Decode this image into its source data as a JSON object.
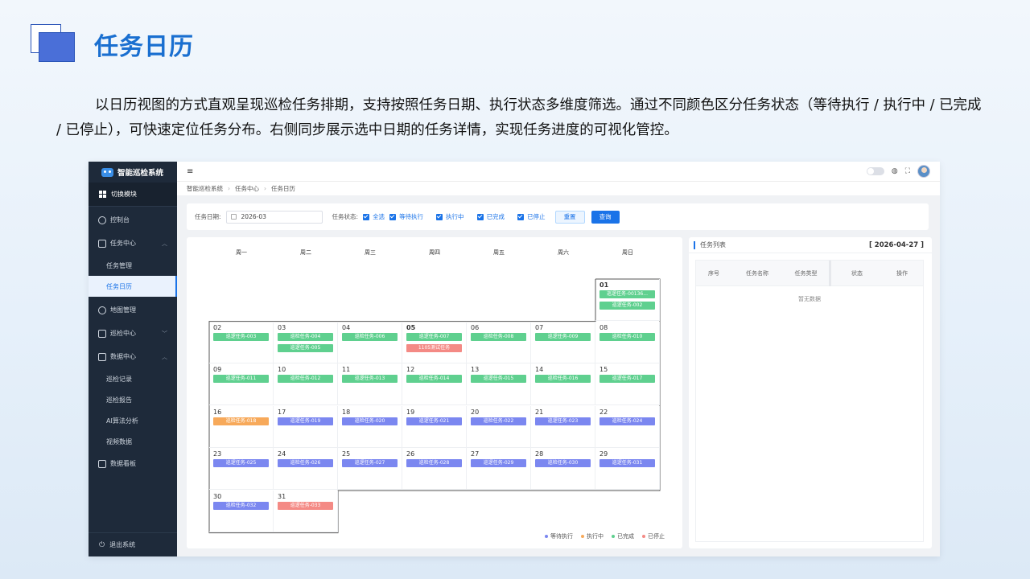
{
  "slide": {
    "title": "任务日历",
    "description": "以日历视图的方式直观呈现巡检任务排期，支持按照任务日期、执行状态多维度筛选。通过不同颜色区分任务状态（等待执行 / 执行中 / 已完成 / 已停止），可快速定位任务分布。右侧同步展示选中日期的任务详情，实现任务进度的可视化管控。"
  },
  "app": {
    "brand": "智能巡检系统",
    "module_switch": "切换模块",
    "nav": {
      "console": "控制台",
      "task_center": "任务中心",
      "task_manage": "任务管理",
      "task_calendar": "任务日历",
      "map_manage": "地图管理",
      "inspect_center": "巡检中心",
      "data_center": "数据中心",
      "inspect_record": "巡检记录",
      "inspect_report": "巡检报告",
      "ai_analysis": "AI算法分析",
      "video_data": "视频数据",
      "data_board": "数据看板",
      "logout": "退出系统"
    },
    "breadcrumb": [
      "智能巡检系统",
      "任务中心",
      "任务日历"
    ],
    "filter": {
      "date_label": "任务日期:",
      "date_value": "2026-03",
      "status_label": "任务状态:",
      "options": [
        "全选",
        "等待执行",
        "执行中",
        "已完成",
        "已停止"
      ],
      "reset": "重置",
      "query": "查询"
    },
    "weekdays": [
      "周一",
      "周二",
      "周三",
      "周四",
      "周五",
      "周六",
      "周日"
    ],
    "legend": [
      {
        "label": "等待执行",
        "color": "#7b87f0"
      },
      {
        "label": "执行中",
        "color": "#f7a95a"
      },
      {
        "label": "已完成",
        "color": "#5fd08f"
      },
      {
        "label": "已停止",
        "color": "#f48a85"
      }
    ],
    "days": [
      {
        "day": "01",
        "col": 6,
        "row": 0,
        "bold": true,
        "tasks": [
          {
            "name": "巡逻任务-00136...",
            "s": "done"
          },
          {
            "name": "巡逻任务-002",
            "s": "done"
          }
        ]
      },
      {
        "day": "02",
        "col": 0,
        "row": 1,
        "tasks": [
          {
            "name": "巡逻任务-003",
            "s": "done"
          }
        ]
      },
      {
        "day": "03",
        "col": 1,
        "row": 1,
        "tasks": [
          {
            "name": "巡检任务-004",
            "s": "done"
          },
          {
            "name": "巡逻任务-005",
            "s": "done"
          }
        ]
      },
      {
        "day": "04",
        "col": 2,
        "row": 1,
        "tasks": [
          {
            "name": "巡检任务-006",
            "s": "done"
          }
        ]
      },
      {
        "day": "05",
        "col": 3,
        "row": 1,
        "bold": true,
        "tasks": [
          {
            "name": "巡逻任务-007",
            "s": "done"
          },
          {
            "name": "1105测试任务",
            "s": "stop"
          }
        ]
      },
      {
        "day": "06",
        "col": 4,
        "row": 1,
        "tasks": [
          {
            "name": "巡检任务-008",
            "s": "done"
          }
        ]
      },
      {
        "day": "07",
        "col": 5,
        "row": 1,
        "tasks": [
          {
            "name": "巡逻任务-009",
            "s": "done"
          }
        ]
      },
      {
        "day": "08",
        "col": 6,
        "row": 1,
        "tasks": [
          {
            "name": "巡检任务-010",
            "s": "done"
          }
        ]
      },
      {
        "day": "09",
        "col": 0,
        "row": 2,
        "tasks": [
          {
            "name": "巡逻任务-011",
            "s": "done"
          }
        ]
      },
      {
        "day": "10",
        "col": 1,
        "row": 2,
        "tasks": [
          {
            "name": "巡检任务-012",
            "s": "done"
          }
        ]
      },
      {
        "day": "11",
        "col": 2,
        "row": 2,
        "tasks": [
          {
            "name": "巡逻任务-013",
            "s": "done"
          }
        ]
      },
      {
        "day": "12",
        "col": 3,
        "row": 2,
        "tasks": [
          {
            "name": "巡检任务-014",
            "s": "done"
          }
        ]
      },
      {
        "day": "13",
        "col": 4,
        "row": 2,
        "tasks": [
          {
            "name": "巡逻任务-015",
            "s": "done"
          }
        ]
      },
      {
        "day": "14",
        "col": 5,
        "row": 2,
        "tasks": [
          {
            "name": "巡检任务-016",
            "s": "done"
          }
        ]
      },
      {
        "day": "15",
        "col": 6,
        "row": 2,
        "tasks": [
          {
            "name": "巡逻任务-017",
            "s": "done"
          }
        ]
      },
      {
        "day": "16",
        "col": 0,
        "row": 3,
        "tasks": [
          {
            "name": "巡检任务-018",
            "s": "run"
          }
        ]
      },
      {
        "day": "17",
        "col": 1,
        "row": 3,
        "tasks": [
          {
            "name": "巡逻任务-019",
            "s": "wait"
          }
        ]
      },
      {
        "day": "18",
        "col": 2,
        "row": 3,
        "tasks": [
          {
            "name": "巡检任务-020",
            "s": "wait"
          }
        ]
      },
      {
        "day": "19",
        "col": 3,
        "row": 3,
        "tasks": [
          {
            "name": "巡逻任务-021",
            "s": "wait"
          }
        ]
      },
      {
        "day": "20",
        "col": 4,
        "row": 3,
        "tasks": [
          {
            "name": "巡检任务-022",
            "s": "wait"
          }
        ]
      },
      {
        "day": "21",
        "col": 5,
        "row": 3,
        "tasks": [
          {
            "name": "巡逻任务-023",
            "s": "wait"
          }
        ]
      },
      {
        "day": "22",
        "col": 6,
        "row": 3,
        "tasks": [
          {
            "name": "巡检任务-024",
            "s": "wait"
          }
        ]
      },
      {
        "day": "23",
        "col": 0,
        "row": 4,
        "tasks": [
          {
            "name": "巡逻任务-025",
            "s": "wait"
          }
        ]
      },
      {
        "day": "24",
        "col": 1,
        "row": 4,
        "tasks": [
          {
            "name": "巡检任务-026",
            "s": "wait"
          }
        ]
      },
      {
        "day": "25",
        "col": 2,
        "row": 4,
        "tasks": [
          {
            "name": "巡逻任务-027",
            "s": "wait"
          }
        ]
      },
      {
        "day": "26",
        "col": 3,
        "row": 4,
        "tasks": [
          {
            "name": "巡检任务-028",
            "s": "wait"
          }
        ]
      },
      {
        "day": "27",
        "col": 4,
        "row": 4,
        "tasks": [
          {
            "name": "巡逻任务-029",
            "s": "wait"
          }
        ]
      },
      {
        "day": "28",
        "col": 5,
        "row": 4,
        "tasks": [
          {
            "name": "巡检任务-030",
            "s": "wait"
          }
        ]
      },
      {
        "day": "29",
        "col": 6,
        "row": 4,
        "tasks": [
          {
            "name": "巡逻任务-031",
            "s": "wait"
          }
        ]
      },
      {
        "day": "30",
        "col": 0,
        "row": 5,
        "tasks": [
          {
            "name": "巡检任务-032",
            "s": "wait"
          }
        ]
      },
      {
        "day": "31",
        "col": 1,
        "row": 5,
        "tasks": [
          {
            "name": "巡逻任务-033",
            "s": "stop"
          }
        ]
      }
    ],
    "task_list": {
      "title": "任务列表",
      "date": "[ 2026-04-27 ]",
      "columns": [
        "序号",
        "任务名称",
        "任务类型",
        "状态",
        "操作"
      ],
      "empty": "暂无数据"
    }
  }
}
